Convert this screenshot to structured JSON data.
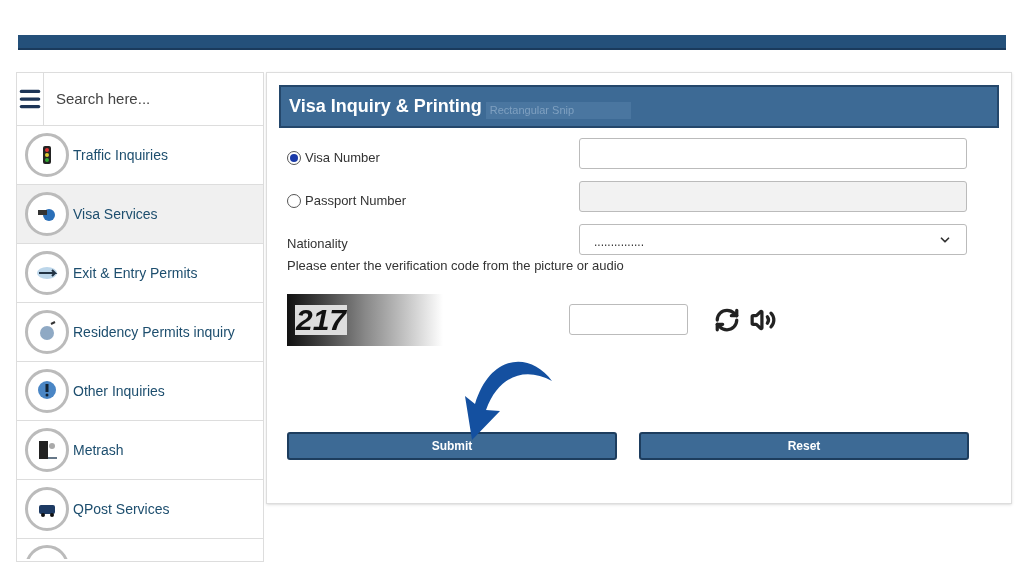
{
  "sidebar": {
    "search": {
      "placeholder": "Search here..."
    },
    "items": [
      {
        "label": "Traffic Inquiries",
        "selected": false
      },
      {
        "label": "Visa Services",
        "selected": true
      },
      {
        "label": "Exit & Entry Permits",
        "selected": false
      },
      {
        "label": "Residency Permits inquiry",
        "selected": false
      },
      {
        "label": "Other Inquiries",
        "selected": false
      },
      {
        "label": "Metrash",
        "selected": false
      },
      {
        "label": "QPost Services",
        "selected": false
      }
    ]
  },
  "panel": {
    "title": "Visa Inquiry & Printing",
    "tooltip": "Rectangular Snip",
    "options": [
      {
        "label": "Visa Number",
        "selected": true
      },
      {
        "label": "Passport Number",
        "selected": false
      }
    ],
    "nationality": {
      "label": "Nationality",
      "value": "..............."
    },
    "captcha_prompt": "Please enter the verification code from the picture or audio",
    "captcha_code": "217",
    "buttons": [
      "Submit",
      "Reset"
    ]
  }
}
